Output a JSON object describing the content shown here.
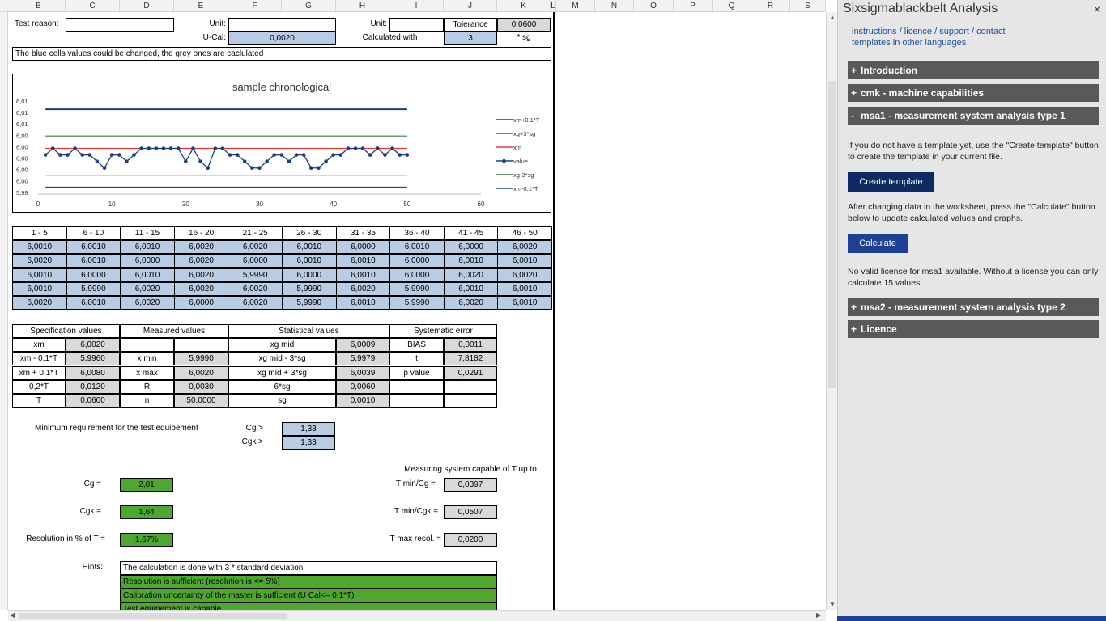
{
  "columns": [
    "B",
    "C",
    "D",
    "E",
    "F",
    "G",
    "H",
    "I",
    "J",
    "K",
    "L",
    "M",
    "N",
    "O",
    "P",
    "Q",
    "R",
    "S"
  ],
  "header": {
    "test_reason_label": "Test reason:",
    "unit_label_1": "Unit:",
    "unit_label_2": "Unit:",
    "tolerance_label": "Tolerance",
    "tolerance_value": "0,0600",
    "ucal_label": "U-Cal:",
    "ucal_value": "0,0020",
    "calculated_with_label": "Calculated with",
    "calculated_with_value": "3",
    "sg_label": "* sg",
    "note": "The blue cells values could be changed, the grey ones are caclulated"
  },
  "chart_data": {
    "type": "line",
    "title": "sample chronological",
    "xlim": [
      0,
      60
    ],
    "x_ticks": [
      "0",
      "10",
      "20",
      "30",
      "40",
      "50",
      "60"
    ],
    "y_ticks": [
      "6,01",
      "6,01",
      "6,01",
      "6,00",
      "6,00",
      "6,00",
      "6,00",
      "6,00",
      "5,99"
    ],
    "series": [
      {
        "name": "xm+0.1*T",
        "color": "#1f3f7a",
        "values": [
          6.008,
          6.008
        ]
      },
      {
        "name": "xg+3*sg",
        "color": "#2e7d32",
        "values": [
          6.0039,
          6.0039
        ]
      },
      {
        "name": "xm",
        "color": "#e53935",
        "values": [
          6.002,
          6.002
        ]
      },
      {
        "name": "value",
        "color": "#1f3f7a",
        "values": [
          6.001,
          6.002,
          6.001,
          6.001,
          6.002,
          6.001,
          6.001,
          6.0,
          5.999,
          6.001,
          6.001,
          6.0,
          6.001,
          6.002,
          6.002,
          6.002,
          6.002,
          6.002,
          6.002,
          6.0,
          6.002,
          6.0,
          5.999,
          6.002,
          6.002,
          6.001,
          6.001,
          6.0,
          5.999,
          5.999,
          6.0,
          6.001,
          6.001,
          6.0,
          6.001,
          6.001,
          5.999,
          5.999,
          6.0,
          6.001,
          6.001,
          6.002,
          6.002,
          6.002,
          6.001,
          6.002,
          6.001,
          6.002,
          6.001,
          6.001
        ]
      },
      {
        "name": "xg-3*sg",
        "color": "#2e7d32",
        "values": [
          5.9979,
          5.9979
        ]
      },
      {
        "name": "xm-0.1*T",
        "color": "#1f3f7a",
        "values": [
          5.996,
          5.996
        ]
      }
    ]
  },
  "samples": {
    "headers": [
      "1 - 5",
      "6 - 10",
      "11 - 15",
      "16 - 20",
      "21 - 25",
      "26 - 30",
      "31 - 35",
      "36 - 40",
      "41 - 45",
      "46 - 50"
    ],
    "rows": [
      [
        "6,0010",
        "6,0010",
        "6,0010",
        "6,0020",
        "6,0020",
        "6,0010",
        "6,0000",
        "6,0010",
        "6,0000",
        "6,0020"
      ],
      [
        "6,0020",
        "6,0010",
        "6,0000",
        "6,0020",
        "6,0000",
        "6,0010",
        "6,0010",
        "6,0000",
        "6,0010",
        "6,0010"
      ],
      [
        "6,0010",
        "6,0000",
        "6,0010",
        "6,0020",
        "5,9990",
        "6,0000",
        "6,0010",
        "6,0000",
        "6,0020",
        "6,0020"
      ],
      [
        "6,0010",
        "5,9990",
        "6,0020",
        "6,0020",
        "6,0020",
        "5,9990",
        "6,0020",
        "5,9990",
        "6,0010",
        "6,0010"
      ],
      [
        "6,0020",
        "6,0010",
        "6,0020",
        "6,0000",
        "6,0020",
        "5,9990",
        "6,0010",
        "5,9990",
        "6,0020",
        "6,0010"
      ]
    ]
  },
  "stats": {
    "headers": [
      "Specification values",
      "Measured values",
      "Statistical values",
      "Systematic error"
    ],
    "rows": [
      [
        "xm",
        "6,0020",
        "",
        "",
        "xg mid",
        "6,0009",
        "BIAS",
        "0,0011"
      ],
      [
        "xm - 0,1*T",
        "5,9960",
        "x min",
        "5,9990",
        "xg mid - 3*sg",
        "5,9979",
        "t",
        "7,8182"
      ],
      [
        "xm + 0,1*T",
        "6,0080",
        "x max",
        "6,0020",
        "xg mid + 3*sg",
        "6,0039",
        "p value",
        "0,0291"
      ],
      [
        "0,2*T",
        "0,0120",
        "R",
        "0,0030",
        "6*sg",
        "0,0060",
        "",
        ""
      ],
      [
        "T",
        "0,0600",
        "n",
        "50,0000",
        "sg",
        "0,0010",
        "",
        ""
      ]
    ]
  },
  "requirements": {
    "label": "Minimum requirement for the test equipement",
    "cg_label": "Cg >",
    "cg_value": "1,33",
    "cgk_label": "Cgk >",
    "cgk_value": "1,33"
  },
  "results": {
    "capable_label": "Measuring system capable of T up to",
    "cg_label": "Cg =",
    "cg_value": "2,01",
    "cgk_label": "Cgk =",
    "cgk_value": "1,64",
    "res_label": "Resolution in % of T =",
    "res_value": "1,67%",
    "tmin_cg_label": "T min/Cg =",
    "tmin_cg_value": "0,0397",
    "tmin_cgk_label": "T min/Cgk =",
    "tmin_cgk_value": "0,0507",
    "tmax_label": "T max resol. =",
    "tmax_value": "0,0200"
  },
  "hints": {
    "label": "Hints:",
    "lines": [
      "The calculation is done with 3 * standard deviation",
      "Resolution is sufficient (resolution is <= 5%)",
      "Calibration uncertainty of the master is sufficient (U Cal<= 0.1*T)",
      "Test equipement is capable"
    ]
  },
  "pane": {
    "title": "Sixsigmablackbelt Analysis",
    "close": "×",
    "link1": "instructions / licence / support / contact",
    "link2": "templates in other languages",
    "sections": {
      "intro": {
        "pm": "+",
        "label": "Introduction"
      },
      "cmk": {
        "pm": "+",
        "label": "cmk - machine capabilities"
      },
      "msa1": {
        "pm": "-",
        "label": "msa1 - measurement system analysis type 1"
      },
      "msa2": {
        "pm": "+",
        "label": "msa2 - measurement system analysis type 2"
      },
      "licence": {
        "pm": "+",
        "label": "Licence"
      }
    },
    "text1": "If you do not have a template yet, use the \"Create template\" button to create the template in your current file.",
    "create_btn": "Create template",
    "text2": "After changing data in the worksheet, press the \"Calculate\" button below to update calculated values and graphs.",
    "calc_btn": "Calculate",
    "text3": "No valid license for msa1 available. Without a license you can only calculate 15 values."
  }
}
